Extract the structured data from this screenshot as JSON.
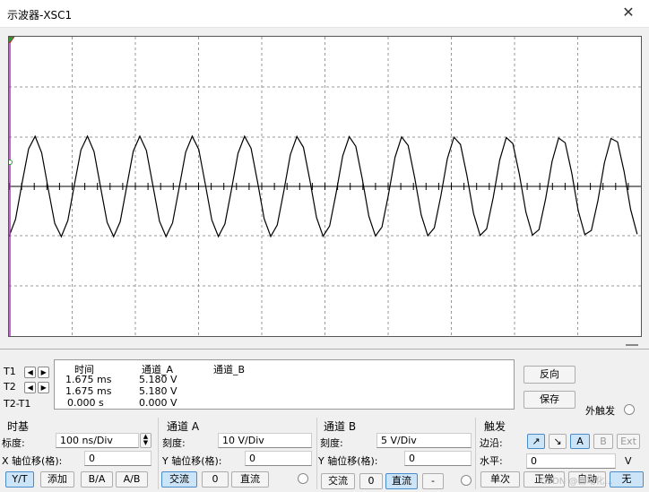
{
  "window": {
    "title": "示波器-XSC1",
    "close_glyph": "✕"
  },
  "cursors": {
    "t1": "T1",
    "t2": "T2",
    "delta": "T2-T1",
    "left_arrow": "◀",
    "right_arrow": "▶"
  },
  "readout": {
    "headers": [
      "时间",
      "通道_A",
      "通道_B"
    ],
    "rows": [
      [
        "1.675 ms",
        "5.180 V",
        ""
      ],
      [
        "1.675 ms",
        "5.180 V",
        ""
      ],
      [
        "0.000 s",
        "0.000 V",
        ""
      ]
    ]
  },
  "side_buttons": {
    "reverse": "反向",
    "save": "保存",
    "ext_trigger": "外触发"
  },
  "timebase": {
    "title": "时基",
    "scale_label": "标度:",
    "scale_value": "100 ns/Div",
    "xpos_label": "X 轴位移(格):",
    "xpos_value": "0",
    "modes": [
      "Y/T",
      "添加",
      "B/A",
      "A/B"
    ],
    "selected_mode": "Y/T"
  },
  "channel_a": {
    "title": "通道 A",
    "scale_label": "刻度:",
    "scale_value": "10  V/Div",
    "ypos_label": "Y 轴位移(格):",
    "ypos_value": "0",
    "couplings": [
      "交流",
      "0",
      "直流"
    ],
    "selected": "交流"
  },
  "channel_b": {
    "title": "通道 B",
    "scale_label": "刻度:",
    "scale_value": "5  V/Div",
    "ypos_label": "Y 轴位移(格):",
    "ypos_value": "0",
    "couplings": [
      "交流",
      "0",
      "直流",
      "-"
    ],
    "selected": "直流"
  },
  "trigger": {
    "title": "触发",
    "edge_label": "边沿:",
    "edge_buttons": [
      "↗",
      "↘",
      "A",
      "B",
      "Ext"
    ],
    "level_label": "水平:",
    "level_value": "0",
    "level_unit": "V",
    "modes": [
      "单次",
      "正常",
      "自动",
      "无"
    ],
    "selected_mode": "无"
  },
  "watermark": "CSDN @自动化..."
}
